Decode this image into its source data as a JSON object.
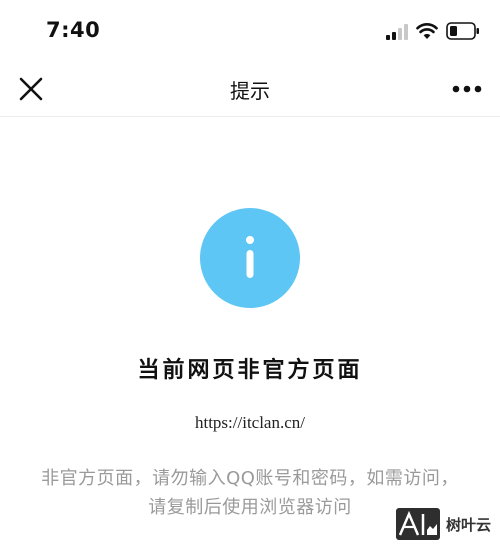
{
  "status_bar": {
    "time": "7:40",
    "icons": [
      "signal-icon",
      "wifi-icon",
      "battery-icon"
    ]
  },
  "nav": {
    "title": "提示",
    "left_icon": "close-icon",
    "right_icon": "more-icon"
  },
  "content": {
    "icon": "info-icon",
    "icon_color": "#5ec6f5",
    "headline": "当前网页非官方页面",
    "url": "https://itclan.cn/",
    "description_lines": [
      "非官方页面，请勿输入QQ账号和密码，如需访问，",
      "请复制后使用浏览器访问"
    ]
  },
  "watermark": {
    "logo_text": "AI",
    "text": "树叶云"
  }
}
